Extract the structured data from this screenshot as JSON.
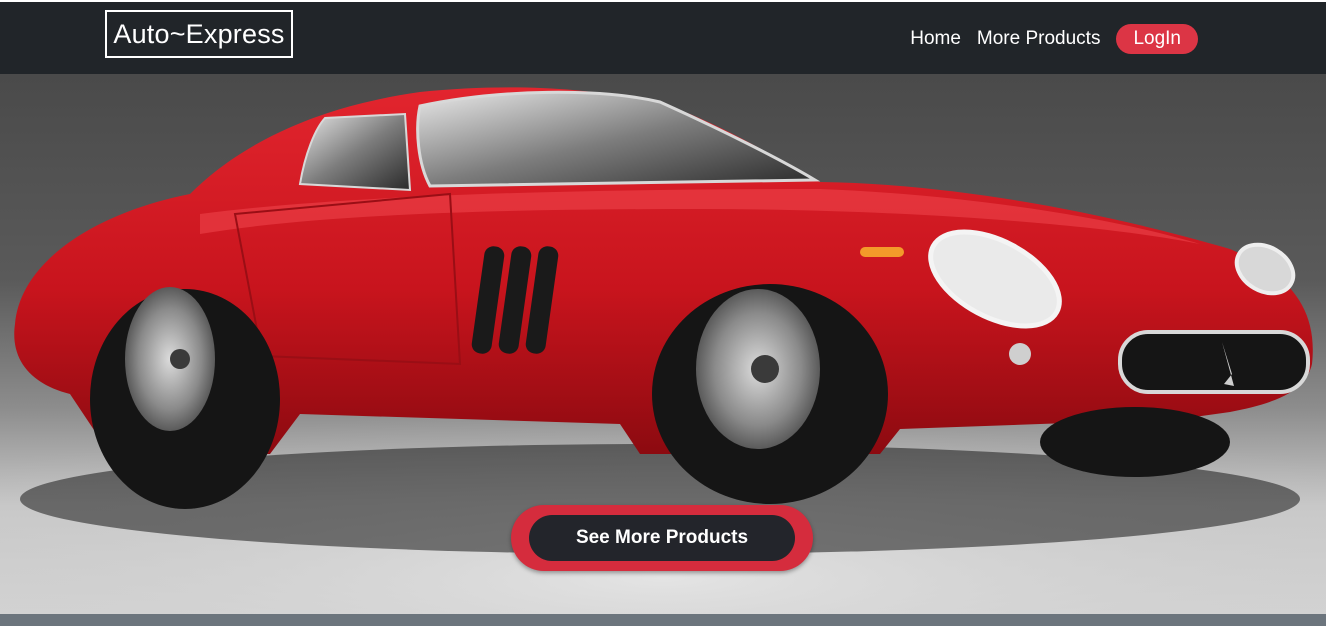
{
  "navbar": {
    "brand": "Auto~Express",
    "links": [
      {
        "label": "Home"
      },
      {
        "label": "More Products"
      }
    ],
    "login_label": "LogIn"
  },
  "hero": {
    "image": "red classic sports car",
    "cta_label": "See More Products"
  },
  "colors": {
    "navbar_bg": "#212529",
    "accent_red": "#dc3545",
    "button_dark": "#23252b",
    "footer_bar": "#6c757d"
  }
}
